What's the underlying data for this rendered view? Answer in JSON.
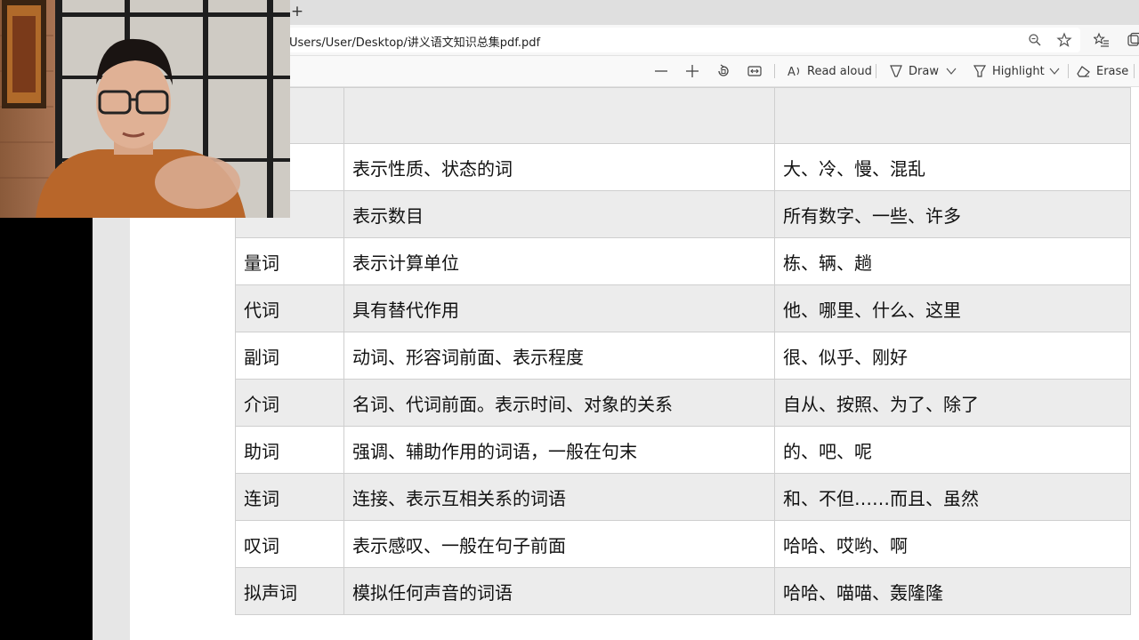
{
  "browser": {
    "new_tab_label": "+",
    "address_url": "Users/User/Desktop/讲义语文知识总集pdf.pdf",
    "icons": [
      "zoom-icon",
      "favorite-star-icon",
      "favorites-list-icon",
      "collections-icon"
    ]
  },
  "pdf_toolbar": {
    "read_aloud_label": "Read aloud",
    "draw_label": "Draw",
    "highlight_label": "Highlight",
    "erase_label": "Erase",
    "icons": [
      "zoom-out-icon",
      "zoom-in-icon",
      "rotate-icon",
      "fit-page-icon",
      "read-aloud-icon",
      "draw-icon",
      "chevron-down-icon",
      "highlight-icon",
      "erase-icon"
    ]
  },
  "table": {
    "rows": [
      {
        "term": "",
        "meaning": "",
        "examples": ""
      },
      {
        "term": "",
        "meaning": "表示性质、状态的词",
        "examples": "大、冷、慢、混乱"
      },
      {
        "term": "",
        "meaning": "表示数目",
        "examples": "所有数字、一些、许多"
      },
      {
        "term": "量词",
        "meaning": "表示计算单位",
        "examples": "栋、辆、趟"
      },
      {
        "term": "代词",
        "meaning": "具有替代作用",
        "examples": "他、哪里、什么、这里"
      },
      {
        "term": "副词",
        "meaning": "动词、形容词前面、表示程度",
        "examples": "很、似乎、刚好"
      },
      {
        "term": "介词",
        "meaning": "名词、代词前面。表示时间、对象的关系",
        "examples": "自从、按照、为了、除了"
      },
      {
        "term": "助词",
        "meaning": "强调、辅助作用的词语，一般在句末",
        "examples": "的、吧、呢"
      },
      {
        "term": "连词",
        "meaning": "连接、表示互相关系的词语",
        "examples": "和、不但……而且、虽然"
      },
      {
        "term": "叹词",
        "meaning": "表示感叹、一般在句子前面",
        "examples": "哈哈、哎哟、啊"
      },
      {
        "term": "拟声词",
        "meaning": "模拟任何声音的词语",
        "examples": "哈哈、喵喵、轰隆隆"
      }
    ]
  },
  "webcam": {
    "description_name": "presenter-webcam-feed"
  }
}
